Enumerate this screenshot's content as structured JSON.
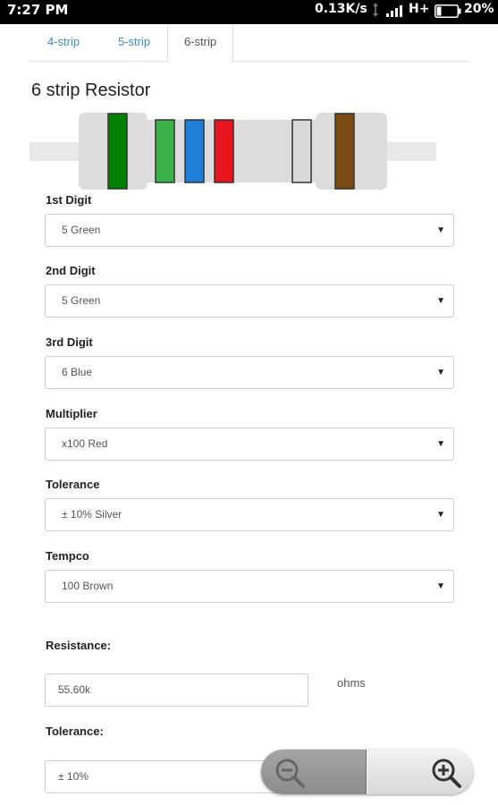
{
  "status_bar": {
    "time": "7:27 PM",
    "speed": "0.13K/s",
    "network": "H+",
    "battery": "20%"
  },
  "tabs": [
    {
      "label": "4-strip",
      "active": false
    },
    {
      "label": "5-strip",
      "active": false
    },
    {
      "label": "6-strip",
      "active": true
    }
  ],
  "page_title": "6 strip Resistor",
  "resistor_bands": {
    "body_color": "#dcdcdc",
    "lead_color": "#e8e8e8",
    "bands": [
      "#008000",
      "#3cb34a",
      "#1e7fd8",
      "#e8141e",
      "#d8d8d8",
      "#7a4a12"
    ]
  },
  "fields": [
    {
      "label": "1st Digit",
      "value": "5 Green"
    },
    {
      "label": "2nd Digit",
      "value": "5 Green"
    },
    {
      "label": "3rd Digit",
      "value": "6 Blue"
    },
    {
      "label": "Multiplier",
      "value": "x100 Red"
    },
    {
      "label": "Tolerance",
      "value": "± 10% Silver"
    },
    {
      "label": "Tempco",
      "value": "100 Brown"
    }
  ],
  "results": {
    "resistance_label": "Resistance:",
    "resistance_value": "55.60k",
    "resistance_unit": "ohms",
    "tolerance_label": "Tolerance:",
    "tolerance_value": "± 10%"
  },
  "zoom_control": {
    "zoom_out_icon": "zoom-out-icon",
    "zoom_in_icon": "zoom-in-icon"
  }
}
